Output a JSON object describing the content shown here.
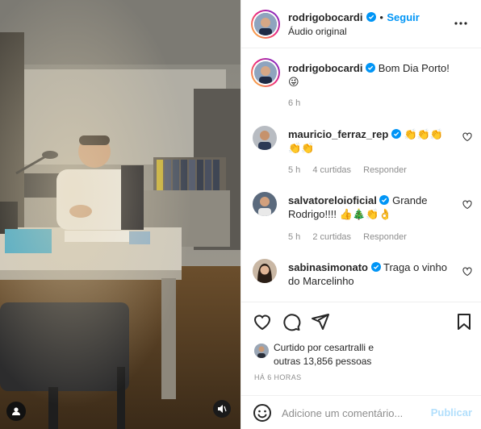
{
  "post": {
    "author": "rodrigobocardi",
    "follow_separator": "•",
    "follow_label": "Seguir",
    "audio": "Áudio original",
    "more_icon": "more-horizontal-icon"
  },
  "caption": {
    "author": "rodrigobocardi",
    "text": "Bom Dia Porto!",
    "emoji": "😜",
    "time": "6 h"
  },
  "comments": [
    {
      "user": "mauricio_ferraz_rep",
      "verified": true,
      "text": "👏👏👏👏👏",
      "time": "5 h",
      "likes": "4 curtidas",
      "reply": "Responder"
    },
    {
      "user": "salvatoreloioficial",
      "verified": false,
      "text": "Grande Rodrigo!!!! 👍🎄👏👌",
      "time": "5 h",
      "likes": "2 curtidas",
      "reply": "Responder"
    },
    {
      "user": "sabinasimonato",
      "verified": true,
      "text": "Traga o vinho do Marcelinho",
      "time": "",
      "likes": "",
      "reply": ""
    }
  ],
  "actions": {
    "liked_prefix": "Curtido por",
    "liked_user": "cesartralli",
    "liked_and": "e",
    "liked_others": "outras 13,856 pessoas",
    "ago": "HÁ 6 HORAS"
  },
  "add_comment": {
    "placeholder": "Adicione um comentário...",
    "publish": "Publicar"
  },
  "colors": {
    "link": "#0095f6",
    "verified": "#0095f6",
    "muted": "#8e8e8e",
    "publish_disabled": "#b2dffc"
  }
}
